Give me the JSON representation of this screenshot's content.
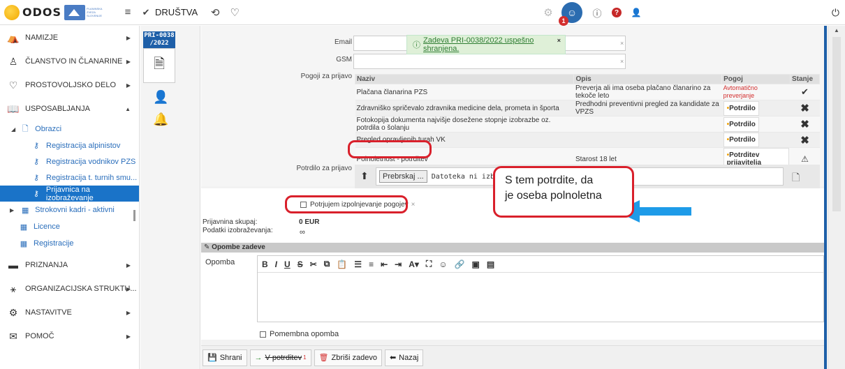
{
  "topbar": {
    "logo": "ODOS",
    "org_logo_text": "PLANINSKA ZVEZA SLOVENIJE",
    "menu_label": "DRUŠTVA"
  },
  "notifications_count": "1",
  "sidebar": {
    "items": [
      {
        "label": "NAMIZJE"
      },
      {
        "label": "ČLANSTVO IN ČLANARINE"
      },
      {
        "label": "PROSTOVOLJSKO DELO"
      },
      {
        "label": "USPOSABLJANJA"
      }
    ],
    "obrazci_label": "Obrazci",
    "obrazci_children": [
      {
        "label": "Registracija alpinistov"
      },
      {
        "label": "Registracija vodnikov PZS"
      },
      {
        "label": "Registracija t. turnih smu..."
      },
      {
        "label": "Prijavnica na izobraževanje"
      }
    ],
    "sub2": [
      {
        "label": "Strokovni kadri - aktivni"
      },
      {
        "label": "Licence"
      },
      {
        "label": "Registracije"
      }
    ],
    "items2": [
      {
        "label": "PRIZNANJA"
      },
      {
        "label": "ORGANIZACIJSKA STRUKTU..."
      },
      {
        "label": "NASTAVITVE"
      },
      {
        "label": "POMOČ"
      }
    ]
  },
  "case": {
    "id": "PRI-0038 /2022"
  },
  "toast": {
    "message": "Zadeva PRI-0038/2022 uspešno shranjena."
  },
  "form": {
    "email_label": "Email",
    "gsm_label": "GSM",
    "pogoji_label": "Pogoji za prijavo",
    "potrdilo_label": "Potrdilo za prijavo",
    "file_button": "Prebrskaj ...",
    "file_status": "Datoteka ni izbrana."
  },
  "grid": {
    "headers": [
      "Naziv",
      "Opis",
      "Pogoj",
      "Stanje"
    ],
    "rows": [
      {
        "naziv": "Plačana članarina PZS",
        "opis": "Preverja ali ima oseba plačano članarino za tekoče leto",
        "pogoj": "Avtomatično preverjanje"
      },
      {
        "naziv": "Zdravniško spričevalo zdravnika medicine dela, prometa in športa",
        "opis": "Predhodni preventivni pregled za kandidate za VPZS",
        "pogoj": "Potrdilo"
      },
      {
        "naziv": "Fotokopija dokumenta najvišje dosežene stopnje izobrazbe oz. potrdila o šolanju",
        "opis": "",
        "pogoj": "Potrdilo"
      },
      {
        "naziv": "Pregled opravljenih turah VK",
        "opis": "",
        "pogoj": "Potrdilo"
      },
      {
        "naziv": "Polnoletnost - potrditev",
        "opis": "Starost 18 let",
        "pogoj": "Potrditev prijavitelja"
      }
    ]
  },
  "confirm": {
    "label": "Potrjujem izpolnjevanje pogojev"
  },
  "summary": {
    "prijavnina_label": "Prijavnina skupaj:",
    "prijavnina_value": "0 EUR",
    "podatki_label": "Podatki izobraževanja:"
  },
  "callout": {
    "line1": "S tem potrdite, da",
    "line2": "je oseba polnoletna"
  },
  "notes": {
    "section_title": "Opombe zadeve",
    "opomba_label": "Opomba",
    "pomembna_label": "Pomembna opomba"
  },
  "footer": {
    "save": "Shrani",
    "confirm": "V potrditev",
    "confirm_badge": "1",
    "delete": "Zbriši zadevo",
    "back": "Nazaj"
  }
}
